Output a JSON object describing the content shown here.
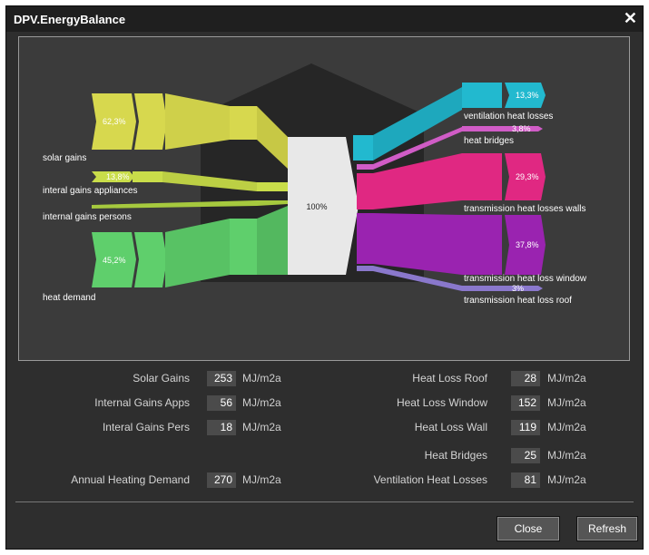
{
  "window": {
    "title": "DPV.EnergyBalance"
  },
  "diagram": {
    "center": "100%",
    "inputs": [
      {
        "label": "solar gains",
        "pct": "62,3%",
        "color": "#d7d84e"
      },
      {
        "label": "interal gains appliances",
        "pct": "13,8%",
        "color": "#c9dd4a"
      },
      {
        "label": "internal gains persons",
        "pct": "",
        "color": "#a6c93e"
      },
      {
        "label": "heat demand",
        "pct": "45,2%",
        "color": "#5fcf6c"
      }
    ],
    "outputs": [
      {
        "label": "ventilation heat losses",
        "pct": "13,3%",
        "color": "#22b9cf"
      },
      {
        "label": "heat bridges",
        "pct": "3,8%",
        "color": "#d05cc6"
      },
      {
        "label": "transmission heat losses walls",
        "pct": "29,3%",
        "color": "#e02882"
      },
      {
        "label": "transmission heat loss window",
        "pct": "37,8%",
        "color": "#9a23b0"
      },
      {
        "label": "transmission heat loss roof",
        "pct": "3%",
        "color": "#8a78cc"
      }
    ]
  },
  "stats": {
    "left": [
      {
        "label": "Solar Gains",
        "value": "253",
        "unit": "MJ/m2a"
      },
      {
        "label": "Internal Gains Apps",
        "value": "56",
        "unit": "MJ/m2a"
      },
      {
        "label": "Interal Gains Pers",
        "value": "18",
        "unit": "MJ/m2a"
      },
      {
        "label": "Annual Heating Demand",
        "value": "270",
        "unit": "MJ/m2a"
      }
    ],
    "right": [
      {
        "label": "Heat Loss Roof",
        "value": "28",
        "unit": "MJ/m2a"
      },
      {
        "label": "Heat Loss Window",
        "value": "152",
        "unit": "MJ/m2a"
      },
      {
        "label": "Heat Loss Wall",
        "value": "119",
        "unit": "MJ/m2a"
      },
      {
        "label": "Heat Bridges",
        "value": "25",
        "unit": "MJ/m2a"
      },
      {
        "label": "Ventilation Heat Losses",
        "value": "81",
        "unit": "MJ/m2a"
      }
    ]
  },
  "buttons": {
    "close": "Close",
    "refresh": "Refresh"
  }
}
